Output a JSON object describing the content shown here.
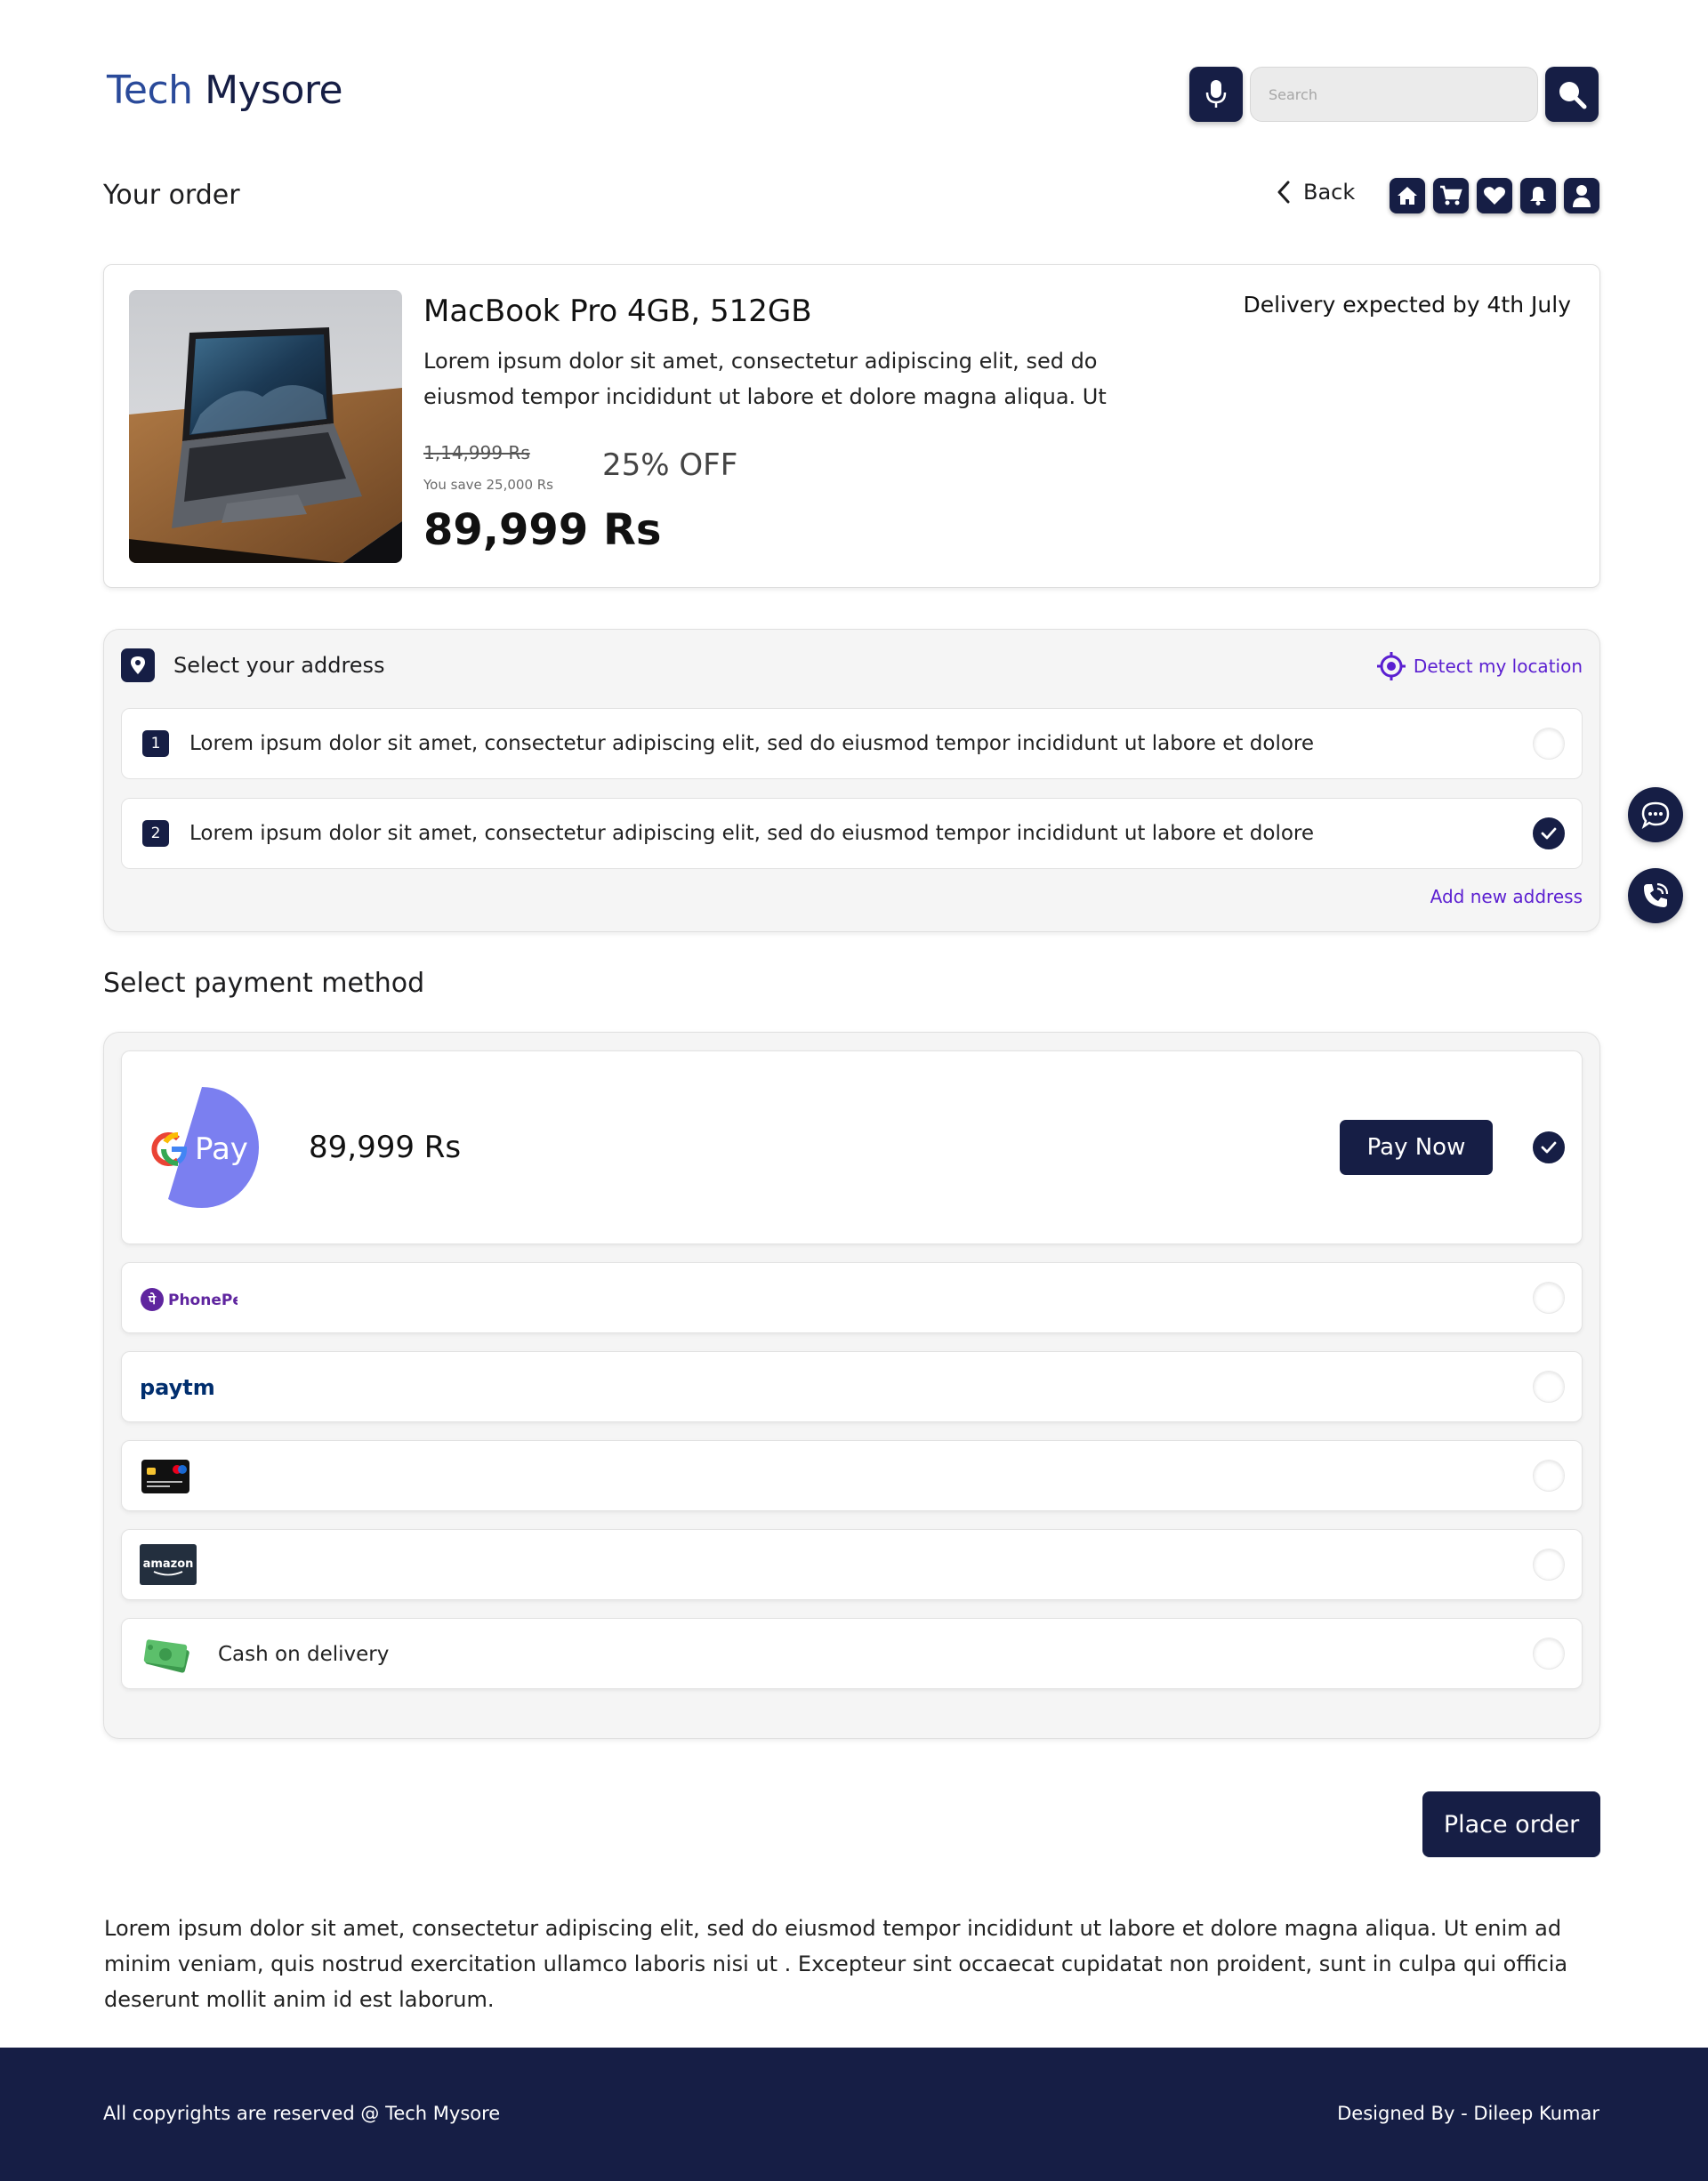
{
  "header": {
    "logo_part1": "Tech",
    "logo_part2": "Mysore",
    "search_placeholder": "Search",
    "mic_icon": "microphone-icon",
    "search_icon": "magnifier-icon"
  },
  "titlebar": {
    "title": "Your order",
    "back_label": "Back",
    "nav_icons": [
      "home-icon",
      "cart-icon",
      "heart-icon",
      "bell-icon",
      "user-icon"
    ]
  },
  "product": {
    "name": "MacBook Pro 4GB, 512GB",
    "description": "Lorem ipsum dolor sit amet, consectetur adipiscing elit, sed do eiusmod tempor incididunt ut labore et dolore magna aliqua. Ut",
    "old_price": "1,14,999 Rs",
    "savings": "You save 25,000 Rs",
    "discount": "25% OFF",
    "price": "89,999 Rs",
    "delivery": "Delivery expected by 4th July"
  },
  "address": {
    "title": "Select your address",
    "detect_label": "Detect my location",
    "items": [
      {
        "num": "1",
        "text": "Lorem ipsum dolor sit amet, consectetur adipiscing elit, sed do eiusmod tempor incididunt ut labore et dolore",
        "selected": false
      },
      {
        "num": "2",
        "text": "Lorem ipsum dolor sit amet, consectetur adipiscing elit, sed do eiusmod tempor incididunt ut labore et dolore",
        "selected": true
      }
    ],
    "add_new_label": "Add new address"
  },
  "payment": {
    "title": "Select payment method",
    "gpay": {
      "logo_text": "Pay",
      "amount": "89,999 Rs",
      "button_label": "Pay Now",
      "selected": true
    },
    "options": [
      {
        "name": "phonepe",
        "logo_text": "PhonePe",
        "selected": false
      },
      {
        "name": "paytm",
        "logo_text": "paytm",
        "selected": false
      },
      {
        "name": "card",
        "logo_text": "",
        "selected": false
      },
      {
        "name": "amazon-pay",
        "logo_text": "amazon",
        "selected": false
      },
      {
        "name": "cash-on-delivery",
        "label": "Cash on delivery",
        "selected": false
      }
    ]
  },
  "actions": {
    "place_order_label": "Place order"
  },
  "info_text": "Lorem ipsum dolor sit amet, consectetur adipiscing elit, sed do eiusmod tempor incididunt ut labore et dolore magna aliqua. Ut enim ad minim veniam, quis nostrud exercitation ullamco laboris nisi ut . Excepteur sint occaecat cupidatat non proident, sunt in culpa qui officia deserunt mollit anim id est laborum.",
  "footer": {
    "copyright": "All copyrights are reserved @ Tech Mysore",
    "designer": "Designed By - Dileep Kumar"
  },
  "colors": {
    "primary": "#161e45",
    "logo_blue": "#2a4a9a",
    "link_purple": "#5b1fd1",
    "gpay_purple": "#7b7ff0"
  }
}
